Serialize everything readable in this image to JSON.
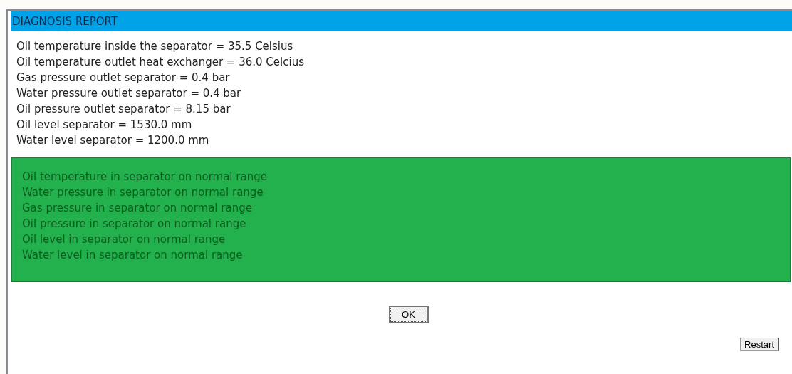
{
  "title": "DIAGNOSIS REPORT",
  "readings": [
    "Oil temperature inside the separator = 35.5 Celsius",
    "Oil temperature outlet heat exchanger = 36.0 Celcius",
    "Gas pressure outlet separator = 0.4 bar",
    "Water pressure outlet separator = 0.4 bar",
    "Oil pressure outlet separator = 8.15 bar",
    "Oil level separator = 1530.0 mm",
    "Water level separator = 1200.0 mm"
  ],
  "status_panel": {
    "color": "#22b14c",
    "messages": [
      "Oil temperature in separator on normal range",
      "Water pressure in separator on normal range",
      "Gas pressure in separator on normal range",
      "Oil pressure in separator on normal range",
      "Oil level in separator on normal range",
      "Water level in separator on normal range"
    ]
  },
  "buttons": [
    "OK",
    "Restart"
  ]
}
